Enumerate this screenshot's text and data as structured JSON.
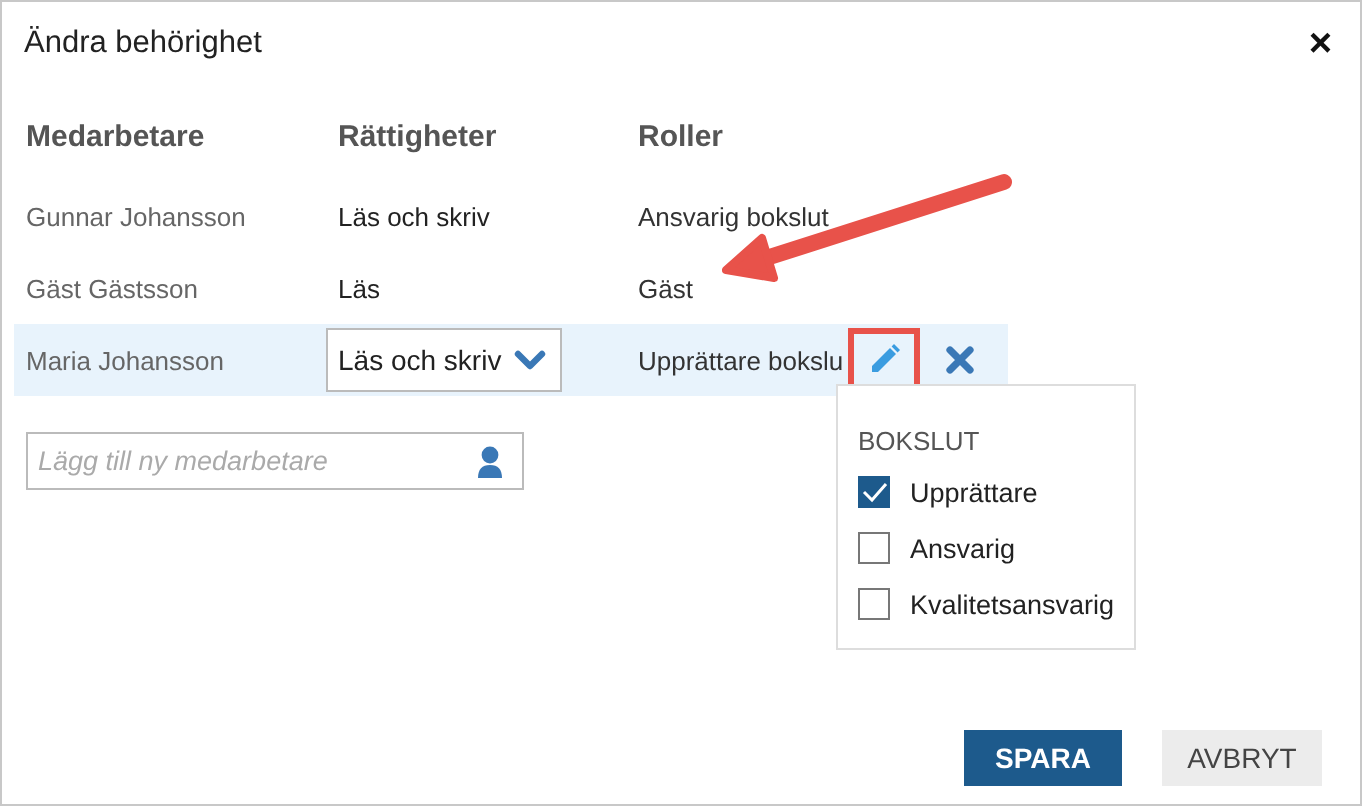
{
  "dialog": {
    "title": "Ändra behörighet",
    "close": "×"
  },
  "columns": [
    "Medarbetare",
    "Rättigheter",
    "Roller"
  ],
  "rows": [
    {
      "name": "Gunnar Johansson",
      "rights": "Läs och skriv",
      "role": "Ansvarig bokslut",
      "selected": false
    },
    {
      "name": "Gäst Gästsson",
      "rights": "Läs",
      "role": "Gäst",
      "selected": false
    },
    {
      "name": "Maria Johansson",
      "rights": "Läs och skriv",
      "role": "Upprättare bokslu",
      "selected": true
    }
  ],
  "add_field": {
    "placeholder": "Lägg till ny medarbetare"
  },
  "role_popup": {
    "heading": "BOKSLUT",
    "options": [
      {
        "label": "Upprättare",
        "checked": true
      },
      {
        "label": "Ansvarig",
        "checked": false
      },
      {
        "label": "Kvalitetsansvarig",
        "checked": false
      }
    ]
  },
  "buttons": [
    {
      "label": "SPARA",
      "kind": "primary"
    },
    {
      "label": "AVBRYT",
      "kind": "secondary"
    }
  ]
}
